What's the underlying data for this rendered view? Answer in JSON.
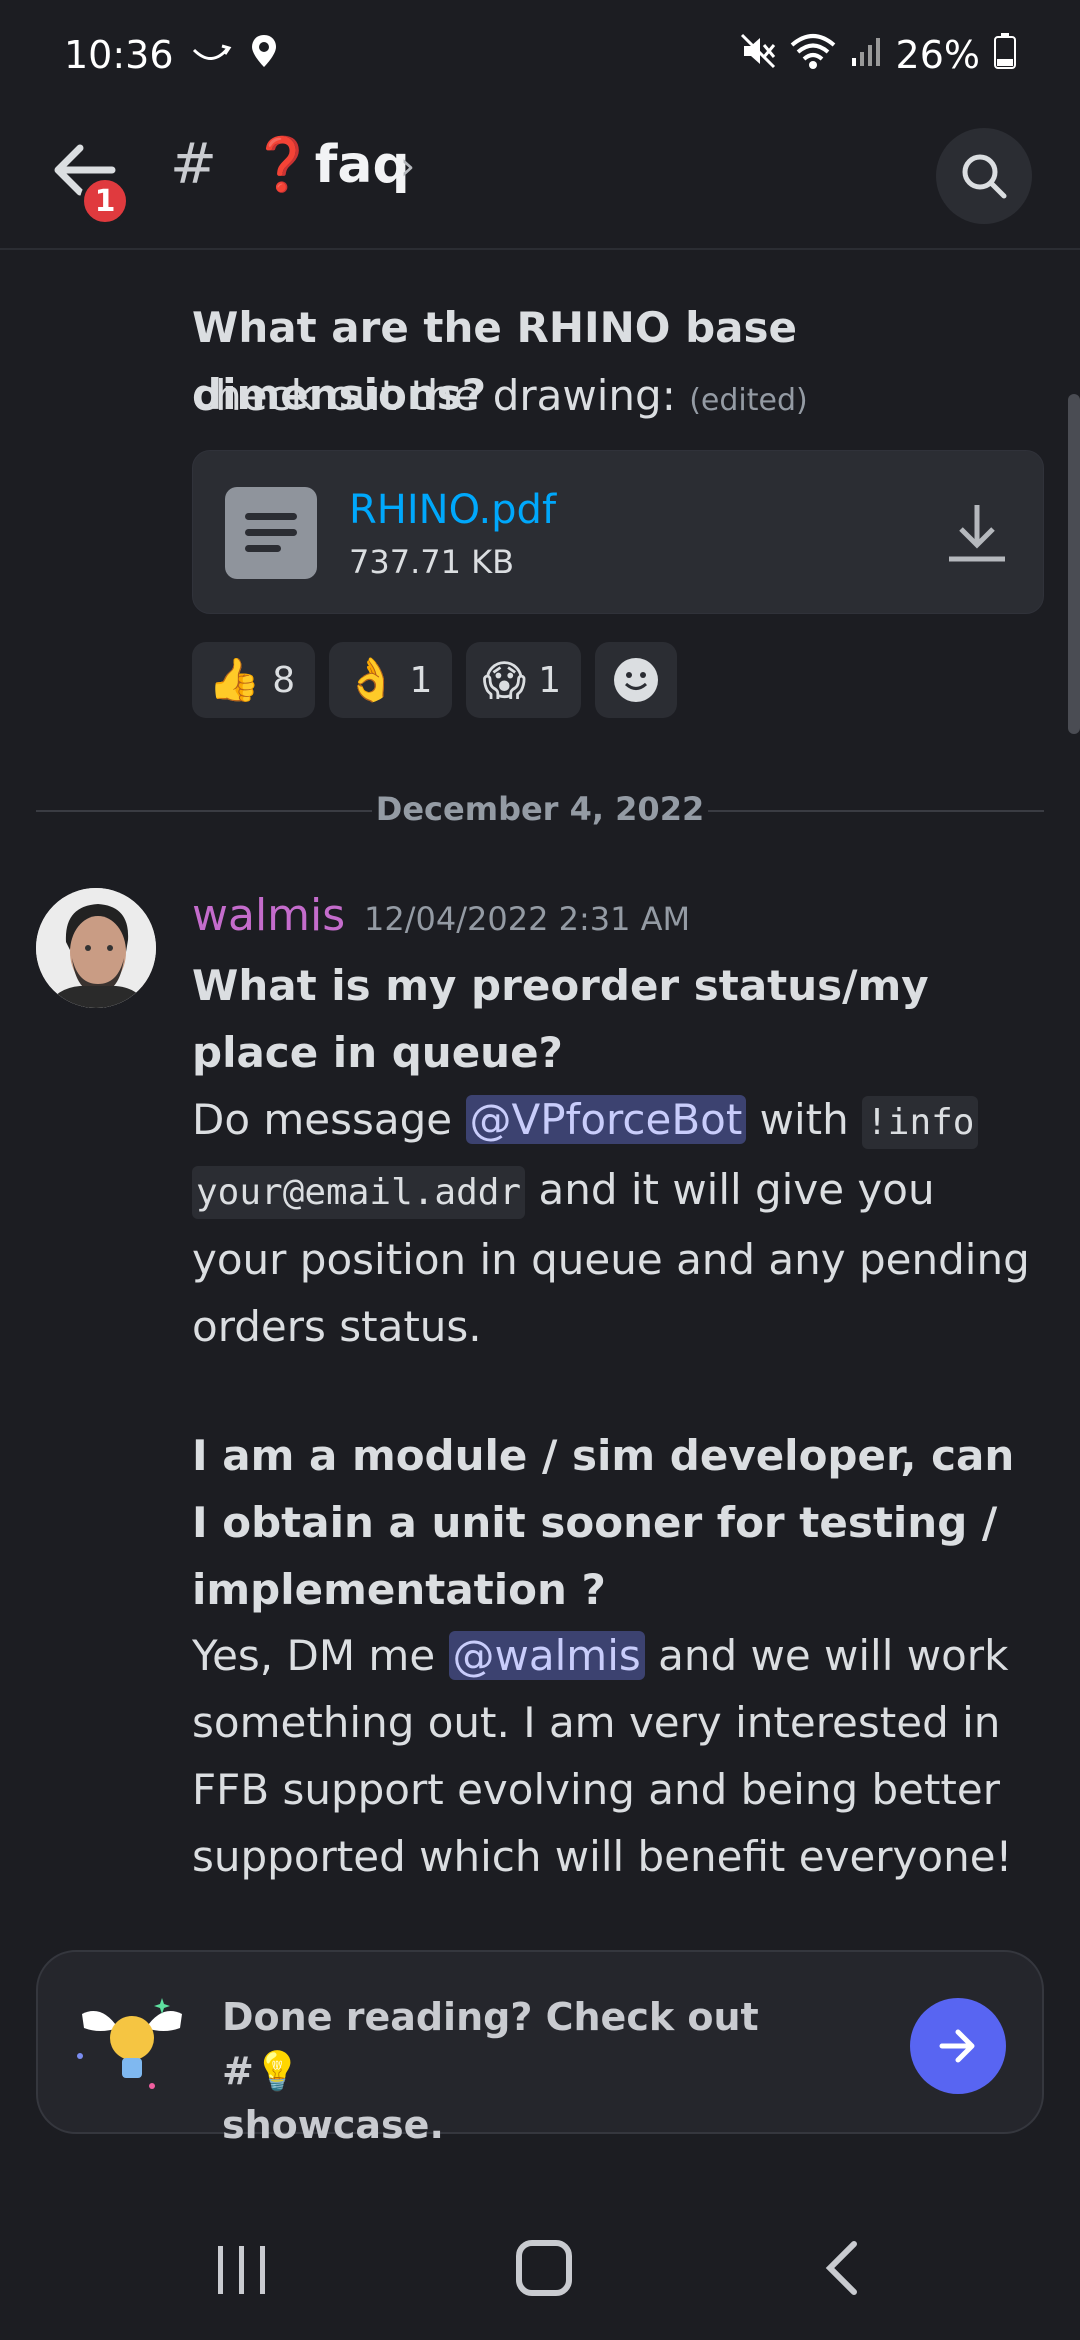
{
  "status_bar": {
    "time": "10:36",
    "battery": "26%",
    "icons": [
      "call-forward-icon",
      "location-icon",
      "mute-icon",
      "wifi-icon",
      "signal-icon",
      "battery-icon"
    ]
  },
  "header": {
    "hash": "#",
    "channel_emoji": "❓",
    "channel_name": "faq",
    "chevron": "›",
    "back_badge": "1"
  },
  "message1": {
    "question": "What are the RHINO base dimensions?",
    "body": "check out the drawing:",
    "edited": "(edited)",
    "attachment": {
      "name": "RHINO.pdf",
      "size": "737.71 KB"
    },
    "reactions": [
      {
        "emoji": "👍",
        "count": "8"
      },
      {
        "emoji": "👌",
        "count": "1"
      },
      {
        "emoji": "😱",
        "count": "1"
      }
    ],
    "add_reaction_emoji": "☻"
  },
  "divider": {
    "date": "December 4, 2022"
  },
  "message2": {
    "username": "walmis",
    "timestamp": "12/04/2022 2:31 AM",
    "q1": "What is my preorder status/my place in queue?",
    "a1_pre": "Do message ",
    "a1_mention": "@VPforceBot",
    "a1_mid": " with ",
    "a1_code1": "!info",
    "a1_code2": "your@email.addr",
    "a1_post": " and it will give you your position in queue and any pending orders status.",
    "q2": "I am a module / sim developer, can I obtain a unit sooner for testing / implementation ?",
    "a2_pre": "Yes, DM me ",
    "a2_mention": "@walmis",
    "a2_post": " and we will work something out. I am very interested in FFB support evolving and being better supported which will benefit everyone!"
  },
  "done_card": {
    "text_pre": "Done reading? Check out #",
    "emoji": "💡",
    "text_post": "showcase."
  },
  "colors": {
    "background": "#1c1d22",
    "link": "#00a8fc",
    "username": "#c46ccc",
    "accent": "#5865f2",
    "badge": "#e03a3e"
  }
}
